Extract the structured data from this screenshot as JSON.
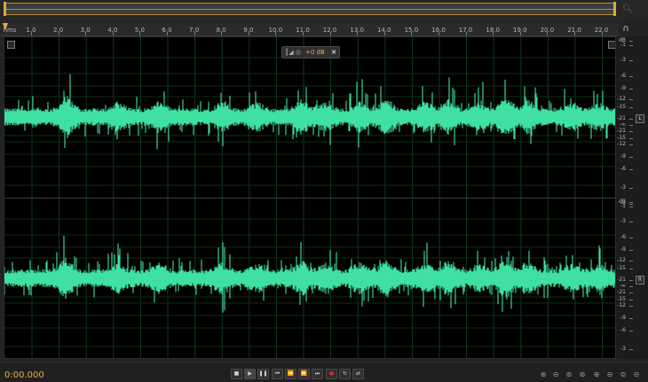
{
  "overview": {
    "zoom_icon": "magnifier-nav-icon"
  },
  "ruler": {
    "unit": "hms",
    "ticks": [
      "1.0",
      "2.0",
      "3.0",
      "4.0",
      "5.0",
      "6.0",
      "7.0",
      "8.0",
      "9.0",
      "10.0",
      "11.0",
      "12.0",
      "13.0",
      "14.0",
      "15.0",
      "16.0",
      "17.0",
      "18.0",
      "19.0",
      "20.0",
      "21.0",
      "22.0"
    ]
  },
  "hud": {
    "volume": "+0 dB"
  },
  "amplitude": {
    "labels": [
      "dB",
      "-1",
      "-3",
      "-6",
      "-9",
      "-12",
      "-15",
      "-21",
      "-∞",
      "-21",
      "-15",
      "-12",
      "-9",
      "-6",
      "-3",
      "-1"
    ]
  },
  "channels": {
    "left": "L",
    "right": "R"
  },
  "transport": {
    "time": "0:00.000",
    "buttons": [
      "stop",
      "play",
      "pause",
      "go-to-start",
      "rewind",
      "fast-forward",
      "go-to-end",
      "record",
      "loop",
      "skip-selection"
    ]
  },
  "colors": {
    "waveform": "#3fe0a0",
    "accent": "#f0b030",
    "background": "#000000"
  }
}
